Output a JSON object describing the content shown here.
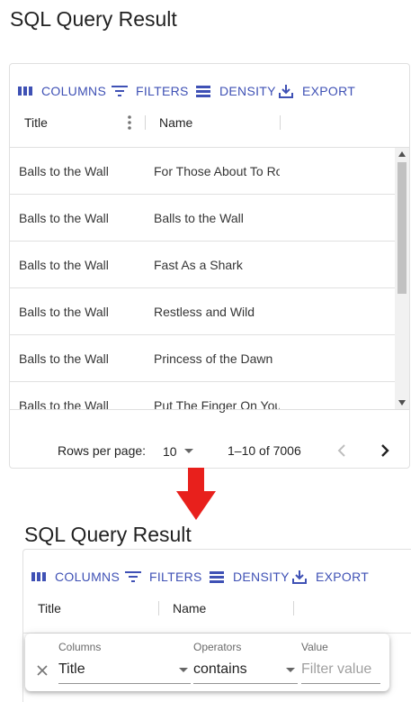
{
  "top_view": {
    "title": "SQL Query Result",
    "toolbar": {
      "columns_label": "COLUMNS",
      "filters_label": "FILTERS",
      "density_label": "DENSITY",
      "export_label": "EXPORT"
    },
    "grid": {
      "columns": [
        "Title",
        "Name"
      ],
      "rows": [
        {
          "title": "Balls to the Wall",
          "name": "For Those About To Rock (We Salute You)"
        },
        {
          "title": "Balls to the Wall",
          "name": "Balls to the Wall"
        },
        {
          "title": "Balls to the Wall",
          "name": "Fast As a Shark"
        },
        {
          "title": "Balls to the Wall",
          "name": "Restless and Wild"
        },
        {
          "title": "Balls to the Wall",
          "name": "Princess of the Dawn"
        },
        {
          "title": "Balls to the Wall",
          "name": "Put The Finger On You"
        }
      ]
    },
    "pagination": {
      "rows_per_page_label": "Rows per page:",
      "rows_per_page_value": "10",
      "range_text": "1–10 of 7006"
    }
  },
  "bottom_view": {
    "title": "SQL Query Result",
    "toolbar": {
      "columns_label": "COLUMNS",
      "filters_label": "FILTERS",
      "density_label": "DENSITY",
      "export_label": "EXPORT"
    },
    "columns": [
      "Title",
      "Name"
    ],
    "filter_panel": {
      "columns_label": "Columns",
      "columns_value": "Title",
      "operators_label": "Operators",
      "operators_value": "contains",
      "value_label": "Value",
      "value_placeholder": "Filter value"
    }
  },
  "colors": {
    "accent": "#3f51b5",
    "arrow": "#e8201c",
    "border": "#e0e0e0"
  },
  "icons": [
    "columns-icon",
    "filter-icon",
    "density-icon",
    "export-icon",
    "kebab-menu-icon",
    "chevron-down-icon",
    "chevron-left-icon",
    "chevron-right-icon",
    "scroll-up-icon",
    "scroll-down-icon",
    "red-down-arrow-icon",
    "close-icon"
  ]
}
